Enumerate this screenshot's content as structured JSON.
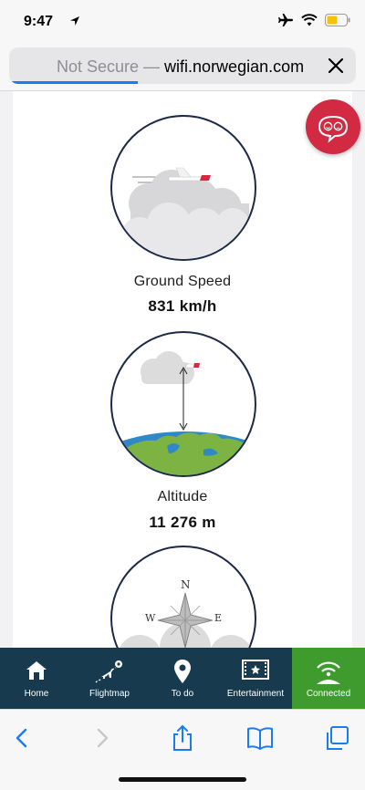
{
  "status_bar": {
    "time": "9:47"
  },
  "browser": {
    "url_prefix": "Not Secure — ",
    "url_domain": "wifi.norwegian.com",
    "load_progress": 0.37
  },
  "metrics": [
    {
      "label": "Ground Speed",
      "value": "831 km/h"
    },
    {
      "label": "Altitude",
      "value": "11 276 m"
    }
  ],
  "compass": {
    "n": "N",
    "w": "W",
    "e": "E"
  },
  "nav": {
    "items": [
      {
        "label": "Home",
        "icon": "home-icon"
      },
      {
        "label": "Flightmap",
        "icon": "flightmap-icon"
      },
      {
        "label": "To do",
        "icon": "location-pin-icon"
      },
      {
        "label": "Entertainment",
        "icon": "film-icon"
      },
      {
        "label": "Connected",
        "icon": "wifi-connected-icon"
      }
    ]
  },
  "colors": {
    "nav_bg": "#173a4e",
    "connected_bg": "#3f9b2d",
    "feedback_bg": "#d32a44",
    "accent": "#1a7cf5"
  }
}
